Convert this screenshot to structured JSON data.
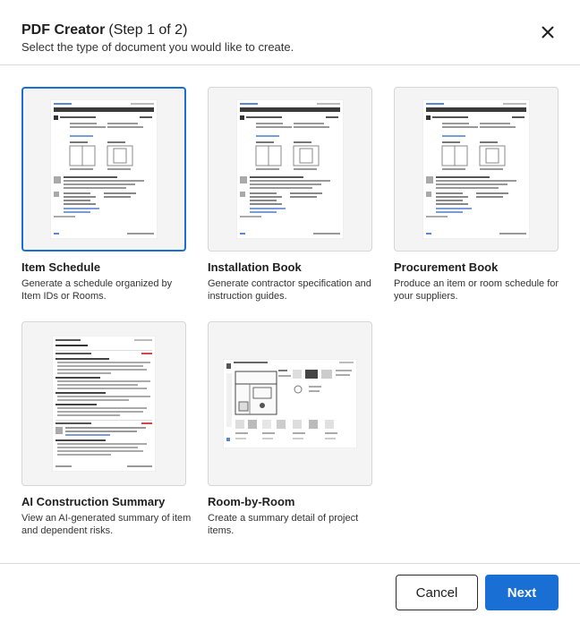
{
  "header": {
    "title": "PDF Creator",
    "step": "(Step 1 of 2)",
    "subtitle": "Select the type of document you would like to create.",
    "close_icon": "close-icon"
  },
  "cards": [
    {
      "title": "Item Schedule",
      "description": "Generate a schedule organized by Item IDs or Rooms.",
      "selected": true
    },
    {
      "title": "Installation Book",
      "description": "Generate contractor specification and instruction guides.",
      "selected": false
    },
    {
      "title": "Procurement Book",
      "description": "Produce an item or room schedule for your suppliers.",
      "selected": false
    },
    {
      "title": "AI Construction Summary",
      "description": "View an AI-generated summary of item and dependent risks.",
      "selected": false
    },
    {
      "title": "Room-by-Room",
      "description": "Create a summary detail of project items.",
      "selected": false
    }
  ],
  "footer": {
    "cancel_label": "Cancel",
    "next_label": "Next"
  },
  "colors": {
    "accent": "#1a6fd4",
    "selected_border": "#1a6fd4"
  }
}
